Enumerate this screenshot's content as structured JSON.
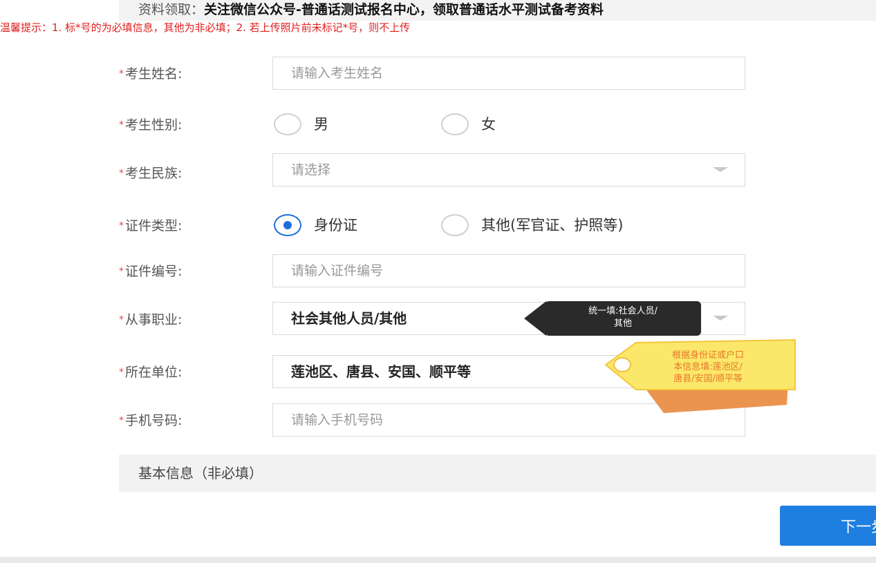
{
  "banner": {
    "label": "资料领取：",
    "text": "关注微信公众号-普通话测试报名中心，领取普通话水平测试备考资料"
  },
  "tip": "温馨提示：1. 标*号的为必填信息，其他为非必填；2. 若上传照片前未标记*号，则不上传",
  "form": {
    "name": {
      "label": "考生姓名:",
      "placeholder": "请输入考生姓名"
    },
    "gender": {
      "label": "考生性别:",
      "options": [
        "男",
        "女"
      ],
      "selected": null
    },
    "ethnicity": {
      "label": "考生民族:",
      "placeholder": "请选择"
    },
    "id_type": {
      "label": "证件类型:",
      "options": [
        "身份证",
        "其他(军官证、护照等)"
      ],
      "selected": "身份证"
    },
    "id_number": {
      "label": "证件编号:",
      "placeholder": "请输入证件编号"
    },
    "occupation": {
      "label": "从事职业:",
      "value": "社会其他人员/其他"
    },
    "employer": {
      "label": "所在单位:",
      "value": "莲池区、唐县、安国、顺平等"
    },
    "phone": {
      "label": "手机号码:",
      "placeholder": "请输入手机号码"
    }
  },
  "required_mark": "*",
  "tooltip": {
    "line1": "统一填:社会人员/",
    "line2": "其他"
  },
  "tag": {
    "line1": "根据身份证或户口",
    "line2": "本信息填:莲池区/",
    "line3": "唐县/安国/顺平等"
  },
  "section": {
    "title": "基本信息（非必填）"
  },
  "next_button": "下一步",
  "colors": {
    "primary": "#1e7fe0",
    "required": "#e64545",
    "tip": "#e02020",
    "tag_fill": "#fbe86a",
    "tag_shadow": "#e9883c"
  }
}
